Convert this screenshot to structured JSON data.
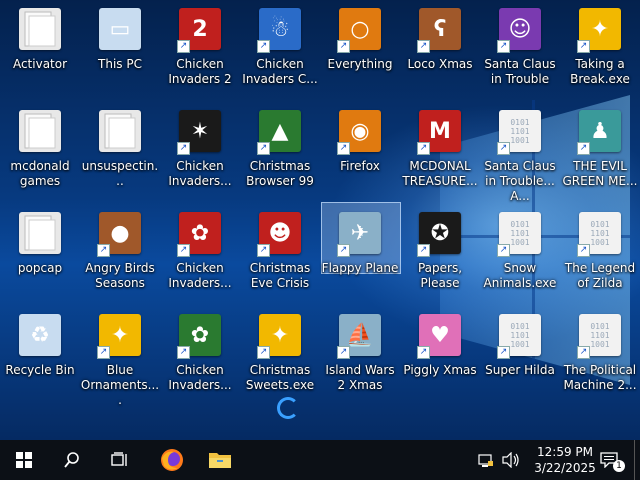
{
  "desktop": {
    "icons": [
      {
        "label": "Activator",
        "icon": "folder-icon"
      },
      {
        "label": "This PC",
        "icon": "computer-icon"
      },
      {
        "label": "Chicken Invaders 2",
        "icon": "chicken-invaders-2-icon"
      },
      {
        "label": "Chicken Invaders C...",
        "icon": "snowman-icon"
      },
      {
        "label": "Everything",
        "icon": "magnifier-icon"
      },
      {
        "label": "Loco Xmas",
        "icon": "teddy-bear-icon"
      },
      {
        "label": "Santa Claus in Trouble",
        "icon": "santa-icon"
      },
      {
        "label": "Taking a Break.exe",
        "icon": "pixel-character-icon"
      },
      {
        "label": "mcdonald games",
        "icon": "folder-icon"
      },
      {
        "label": "unsuspectin...",
        "icon": "folder-icon"
      },
      {
        "label": "Chicken Invaders...",
        "icon": "chicken-invaders-icon"
      },
      {
        "label": "Christmas Browser 99",
        "icon": "christmas-tree-icon"
      },
      {
        "label": "Firefox",
        "icon": "firefox-icon"
      },
      {
        "label": "MCDONAL TREASURE...",
        "icon": "mcdonalds-icon"
      },
      {
        "label": "Santa Claus in Trouble... A...",
        "icon": "binary-file-icon"
      },
      {
        "label": "THE EVIL GREEN ME...",
        "icon": "msn-icon"
      },
      {
        "label": "popcap",
        "icon": "folder-icon"
      },
      {
        "label": "Angry Birds Seasons",
        "icon": "angry-birds-icon"
      },
      {
        "label": "Chicken Invaders...",
        "icon": "chicken-santa-icon"
      },
      {
        "label": "Christmas Eve Crisis",
        "icon": "santa-face-icon"
      },
      {
        "label": "Flappy Plane",
        "icon": "flappy-plane-icon"
      },
      {
        "label": "Papers, Please",
        "icon": "papers-please-icon"
      },
      {
        "label": "Snow Animals.exe",
        "icon": "binary-file-icon"
      },
      {
        "label": "The Legend of Zilda",
        "icon": "binary-file-icon"
      },
      {
        "label": "Recycle Bin",
        "icon": "recycle-bin-icon"
      },
      {
        "label": "Blue Ornaments....",
        "icon": "pixel-character-icon"
      },
      {
        "label": "Chicken Invaders...",
        "icon": "chicken-green-icon"
      },
      {
        "label": "Christmas Sweets.exe",
        "icon": "pixel-character-icon"
      },
      {
        "label": "Island Wars 2 Xmas",
        "icon": "island-wars-icon"
      },
      {
        "label": "Piggly Xmas",
        "icon": "pig-icon"
      },
      {
        "label": "Super Hilda",
        "icon": "binary-file-icon"
      },
      {
        "label": "The Political Machine 2...",
        "icon": "binary-file-icon"
      }
    ],
    "selected_icon": "Flappy Plane",
    "binary_glyph": "0101\n1101\n1001"
  },
  "taskbar": {
    "time": "12:59 PM",
    "date": "3/22/2025",
    "notification_count": "1"
  },
  "colors": {
    "taskbar": "#0c1016",
    "accent": "#3aa0ff"
  }
}
